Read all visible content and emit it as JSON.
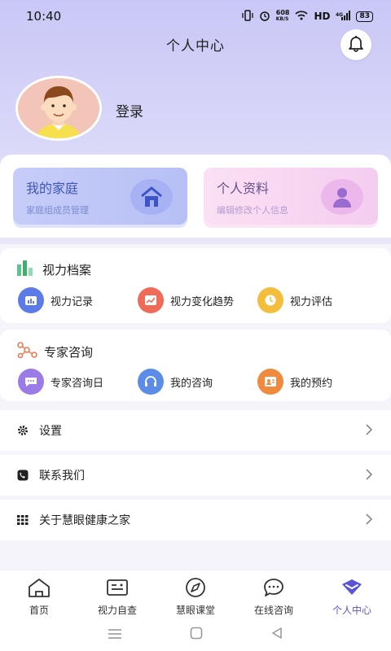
{
  "status_bar": {
    "time": "10:40",
    "network_speed_value": "608",
    "network_speed_unit": "KB/S",
    "hd": "HD",
    "signal": "4G",
    "battery": "83"
  },
  "header": {
    "title": "个人中心"
  },
  "user": {
    "login_label": "登录"
  },
  "cards": {
    "family": {
      "title": "我的家庭",
      "subtitle": "家庭组成员管理"
    },
    "profile": {
      "title": "个人资料",
      "subtitle": "编辑修改个人信息"
    }
  },
  "vision_section": {
    "title": "视力档案",
    "items": [
      {
        "label": "视力记录",
        "icon": "bar-chart-icon",
        "color": "#5b7be8"
      },
      {
        "label": "视力变化趋势",
        "icon": "trend-chart-icon",
        "color": "#ef6b57"
      },
      {
        "label": "视力评估",
        "icon": "clock-icon",
        "color": "#f3be3c"
      }
    ]
  },
  "expert_section": {
    "title": "专家咨询",
    "items": [
      {
        "label": "专家咨询日",
        "icon": "chat-bubble-icon",
        "color": "#9b7be8"
      },
      {
        "label": "我的咨询",
        "icon": "headset-icon",
        "color": "#5b8de8"
      },
      {
        "label": "我的预约",
        "icon": "user-card-icon",
        "color": "#f08a3e"
      }
    ]
  },
  "menu": [
    {
      "label": "设置",
      "icon": "gear-icon"
    },
    {
      "label": "联系我们",
      "icon": "phone-icon"
    },
    {
      "label": "关于慧眼健康之家",
      "icon": "grid-icon"
    }
  ],
  "tabs": [
    {
      "label": "首页",
      "icon": "home-icon",
      "active": false
    },
    {
      "label": "视力自查",
      "icon": "eye-chart-icon",
      "active": false
    },
    {
      "label": "慧眼课堂",
      "icon": "compass-icon",
      "active": false
    },
    {
      "label": "在线咨询",
      "icon": "message-icon",
      "active": false
    },
    {
      "label": "个人中心",
      "icon": "diamond-icon",
      "active": true
    }
  ],
  "colors": {
    "accent": "#5b55d6",
    "header_bg": "#c9c7f6"
  }
}
